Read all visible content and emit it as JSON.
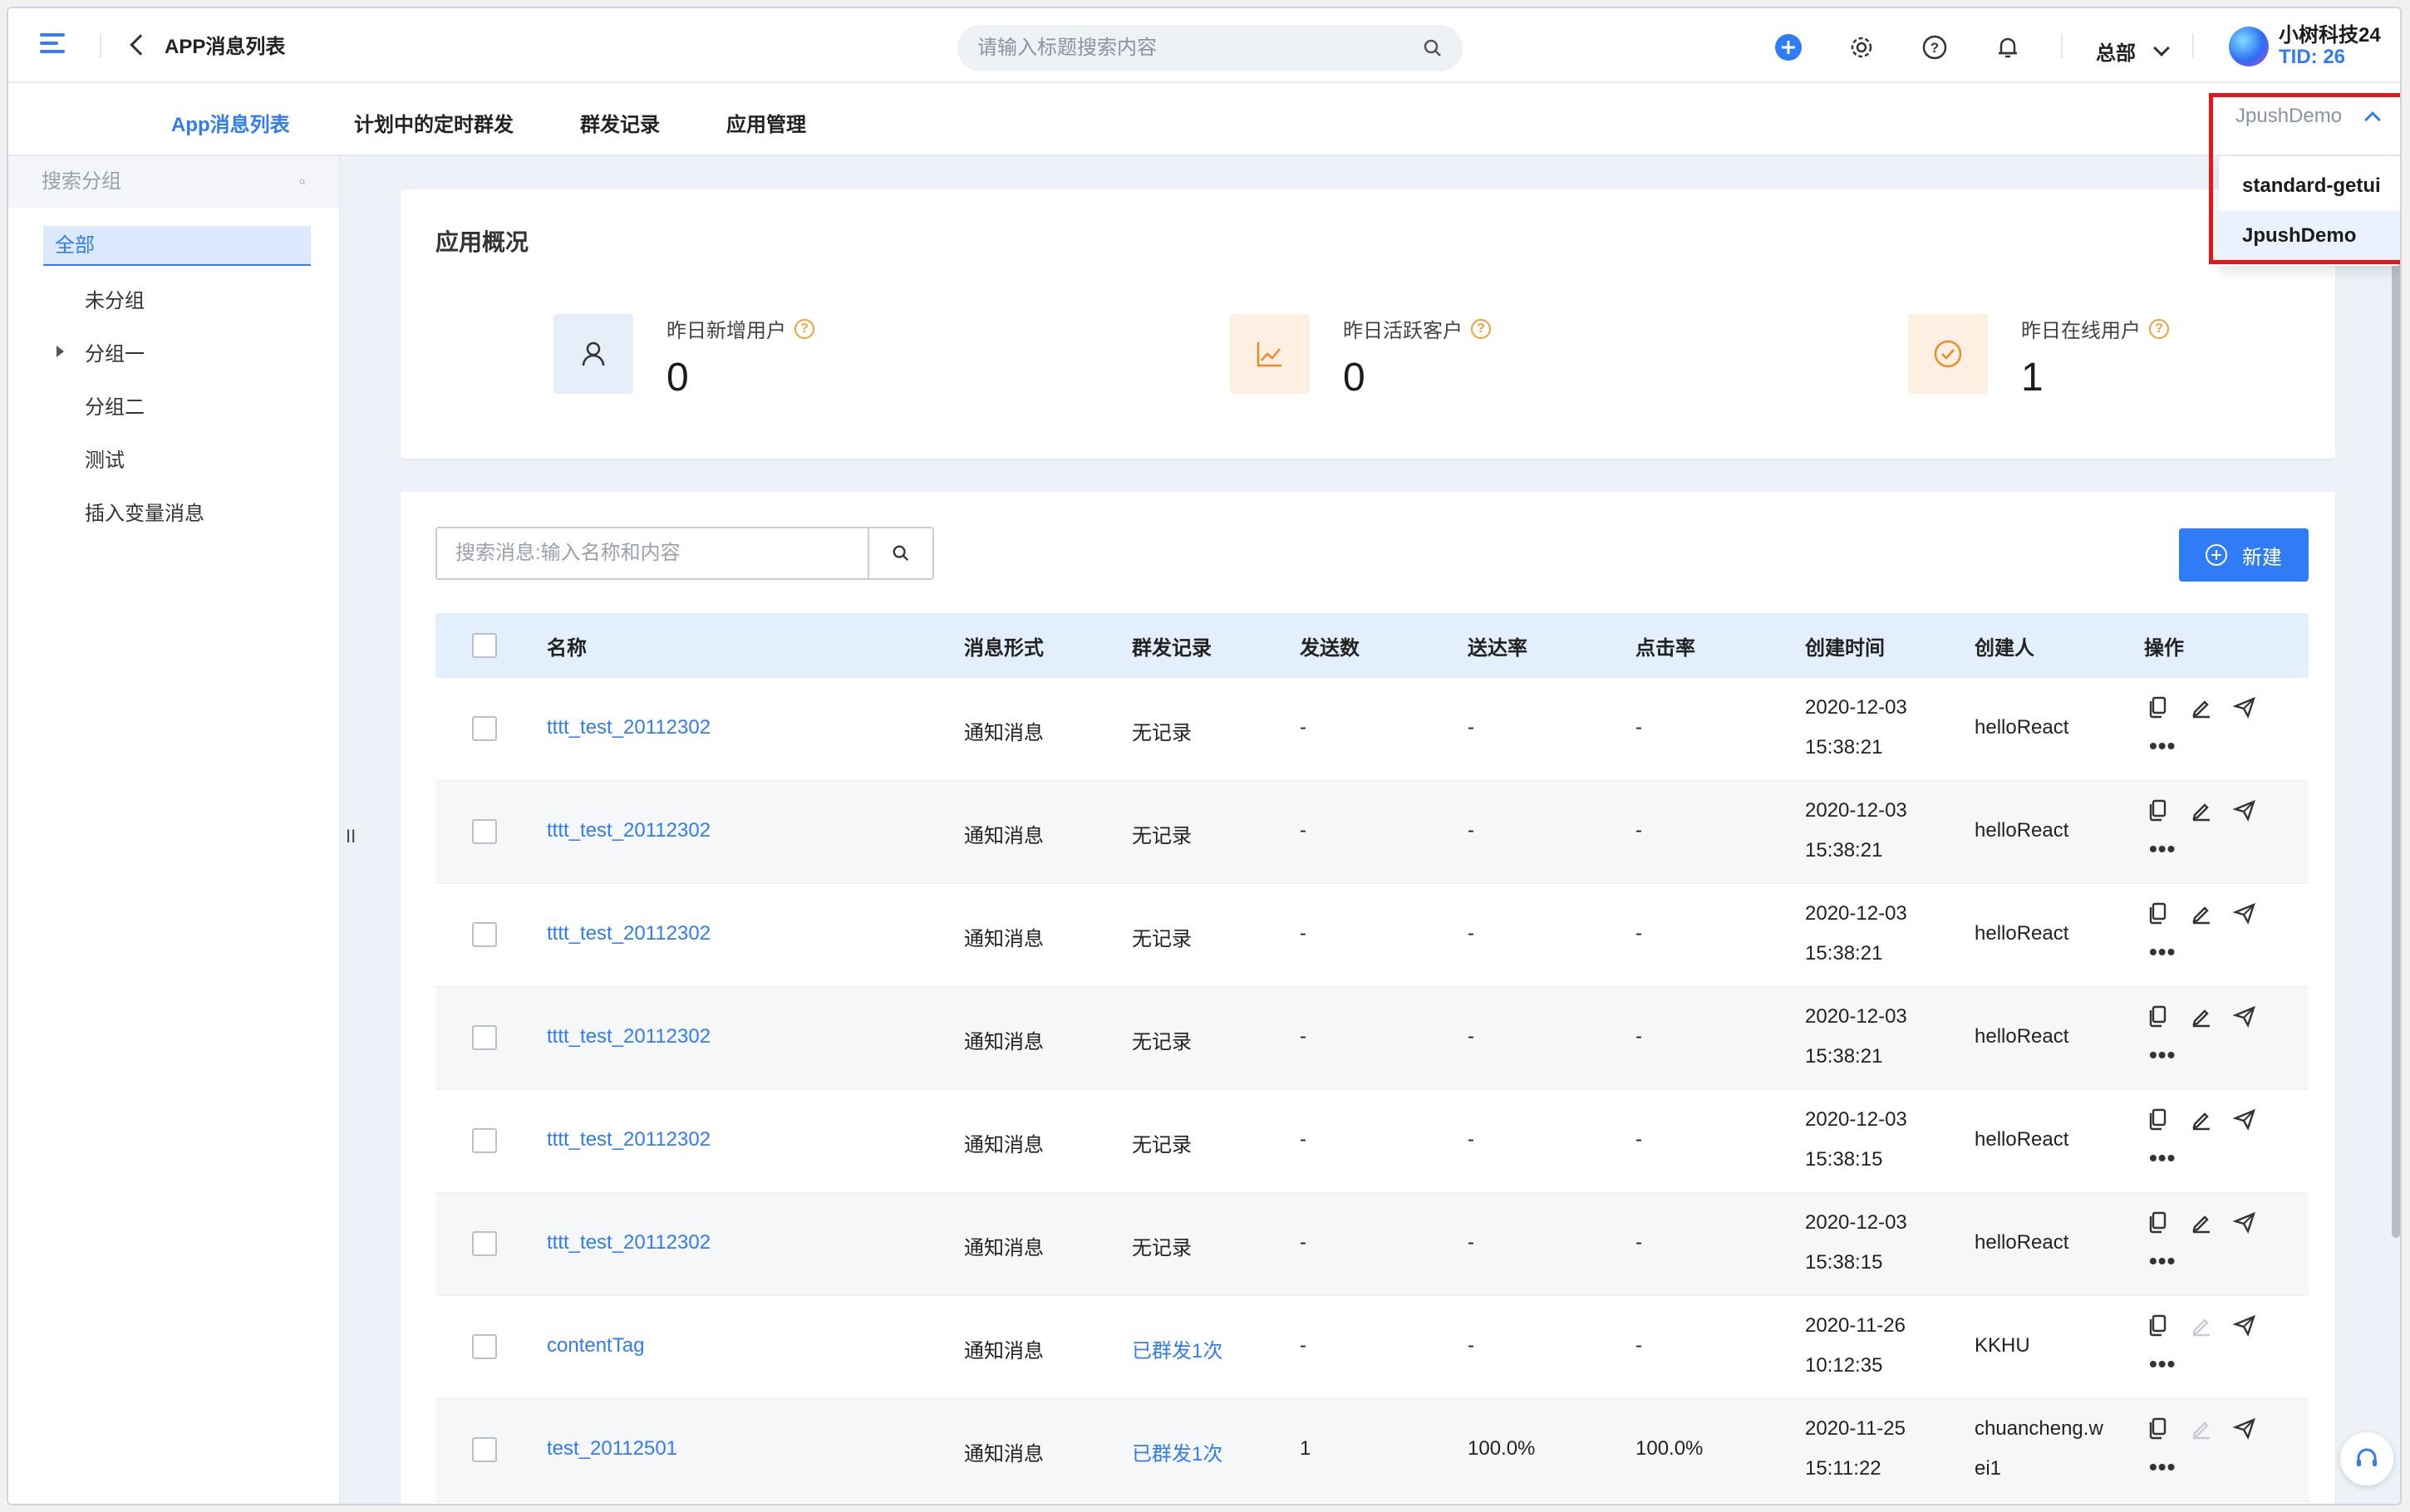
{
  "header": {
    "title": "APP消息列表",
    "search_placeholder": "请输入标题搜索内容",
    "branch": "总部",
    "user_name": "小树科技24",
    "tid": "TID: 26"
  },
  "tabs": [
    {
      "label": "App消息列表",
      "active": true
    },
    {
      "label": "计划中的定时群发",
      "active": false
    },
    {
      "label": "群发记录",
      "active": false
    },
    {
      "label": "应用管理",
      "active": false
    }
  ],
  "app_select": {
    "current": "JpushDemo",
    "options": [
      "standard-getui",
      "JpushDemo"
    ]
  },
  "sidebar": {
    "search_placeholder": "搜索分组",
    "items": [
      "全部",
      "未分组",
      "分组一",
      "分组二",
      "测试",
      "插入变量消息"
    ]
  },
  "overview": {
    "title": "应用概况",
    "stats": [
      {
        "label": "昨日新增用户",
        "value": "0",
        "icon": "user-icon"
      },
      {
        "label": "昨日活跃客户",
        "value": "0",
        "icon": "line-chart-icon"
      },
      {
        "label": "昨日在线用户",
        "value": "1",
        "icon": "check-circle-icon"
      }
    ]
  },
  "list": {
    "search_placeholder": "搜索消息:输入名称和内容",
    "new_button": "新建",
    "columns": [
      "名称",
      "消息形式",
      "群发记录",
      "发送数",
      "送达率",
      "点击率",
      "创建时间",
      "创建人",
      "操作"
    ],
    "rows": [
      {
        "name": "tttt_test_20112302",
        "type": "通知消息",
        "record": "无记录",
        "sent": "-",
        "delivery": "-",
        "click": "-",
        "date": "2020-12-03",
        "time": "15:38:21",
        "creator": "helloReact",
        "creator2": "",
        "edit_enabled": true,
        "record_link": false
      },
      {
        "name": "tttt_test_20112302",
        "type": "通知消息",
        "record": "无记录",
        "sent": "-",
        "delivery": "-",
        "click": "-",
        "date": "2020-12-03",
        "time": "15:38:21",
        "creator": "helloReact",
        "creator2": "",
        "edit_enabled": true,
        "record_link": false
      },
      {
        "name": "tttt_test_20112302",
        "type": "通知消息",
        "record": "无记录",
        "sent": "-",
        "delivery": "-",
        "click": "-",
        "date": "2020-12-03",
        "time": "15:38:21",
        "creator": "helloReact",
        "creator2": "",
        "edit_enabled": true,
        "record_link": false
      },
      {
        "name": "tttt_test_20112302",
        "type": "通知消息",
        "record": "无记录",
        "sent": "-",
        "delivery": "-",
        "click": "-",
        "date": "2020-12-03",
        "time": "15:38:21",
        "creator": "helloReact",
        "creator2": "",
        "edit_enabled": true,
        "record_link": false
      },
      {
        "name": "tttt_test_20112302",
        "type": "通知消息",
        "record": "无记录",
        "sent": "-",
        "delivery": "-",
        "click": "-",
        "date": "2020-12-03",
        "time": "15:38:15",
        "creator": "helloReact",
        "creator2": "",
        "edit_enabled": true,
        "record_link": false
      },
      {
        "name": "tttt_test_20112302",
        "type": "通知消息",
        "record": "无记录",
        "sent": "-",
        "delivery": "-",
        "click": "-",
        "date": "2020-12-03",
        "time": "15:38:15",
        "creator": "helloReact",
        "creator2": "",
        "edit_enabled": true,
        "record_link": false
      },
      {
        "name": "contentTag",
        "type": "通知消息",
        "record": "已群发1次",
        "sent": "-",
        "delivery": "-",
        "click": "-",
        "date": "2020-11-26",
        "time": "10:12:35",
        "creator": "KKHU",
        "creator2": "",
        "edit_enabled": false,
        "record_link": true
      },
      {
        "name": "test_20112501",
        "type": "通知消息",
        "record": "已群发1次",
        "sent": "1",
        "delivery": "100.0%",
        "click": "100.0%",
        "date": "2020-11-25",
        "time": "15:11:22",
        "creator": "chuancheng.w",
        "creator2": "ei1",
        "edit_enabled": false,
        "record_link": true
      }
    ]
  },
  "colors": {
    "accent": "#2f7cf6",
    "user_icon_bg": "#e6eef9",
    "orange_icon_bg": "#fdf0e2",
    "orange": "#f08a24"
  }
}
